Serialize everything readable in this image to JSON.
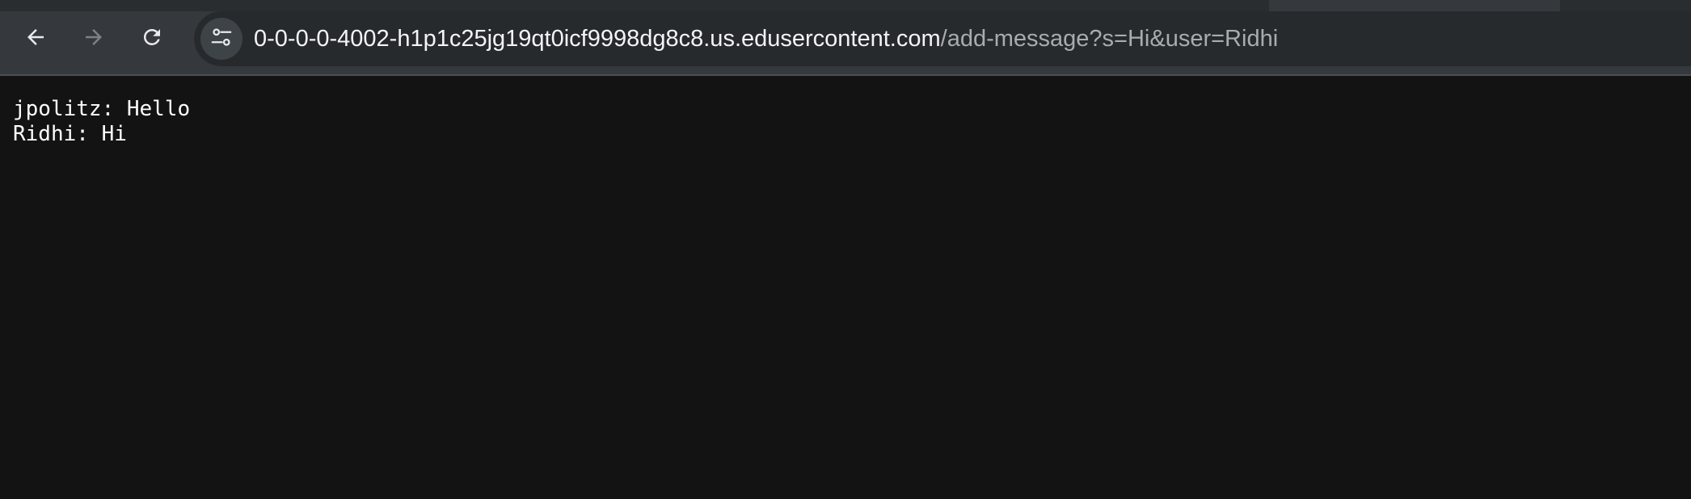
{
  "browser": {
    "url_host": "0-0-0-0-4002-h1p1c25jg19qt0icf9998dg8c8.us.edusercontent.com",
    "url_path": "/add-message?s=Hi&user=Ridhi",
    "icons": {
      "back": "arrow-left-icon",
      "forward": "arrow-right-icon",
      "reload": "reload-icon",
      "site_info": "tune-icon"
    }
  },
  "page": {
    "lines": [
      "jpolitz: Hello",
      "Ridhi: Hi"
    ]
  },
  "colors": {
    "toolbar": "#35393d",
    "omnibox": "#272a2d",
    "page_background": "#131313",
    "text": "#ffffff"
  }
}
